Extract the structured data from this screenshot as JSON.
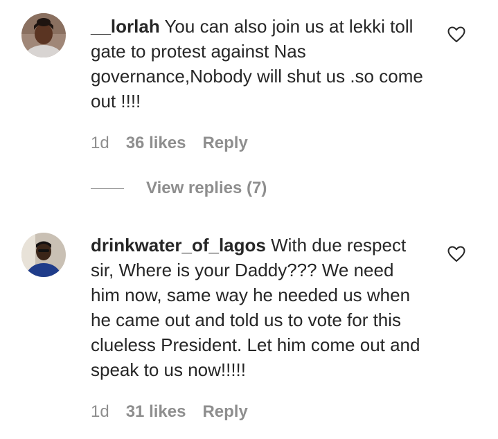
{
  "comments": [
    {
      "username": "__lorlah",
      "text": " You can also join us at lekki toll gate to protest against Nas governance,Nobody will shut us .so come out !!!!",
      "time": "1d",
      "likes": "36 likes",
      "reply_label": "Reply",
      "view_replies": "View replies (7)",
      "avatar_icon": "avatar-photo",
      "like_icon": "heart-outline-icon"
    },
    {
      "username": "drinkwater_of_lagos",
      "text": " With due respect sir, Where is your Daddy??? We need him now, same way he needed us when he came out and told us to vote for this clueless President. Let him come out and speak to us now!!!!!",
      "time": "1d",
      "likes": "31 likes",
      "reply_label": "Reply",
      "avatar_icon": "avatar-photo",
      "like_icon": "heart-outline-icon"
    }
  ],
  "colors": {
    "text": "#262626",
    "secondary": "#8e8e8e",
    "background": "#ffffff"
  }
}
